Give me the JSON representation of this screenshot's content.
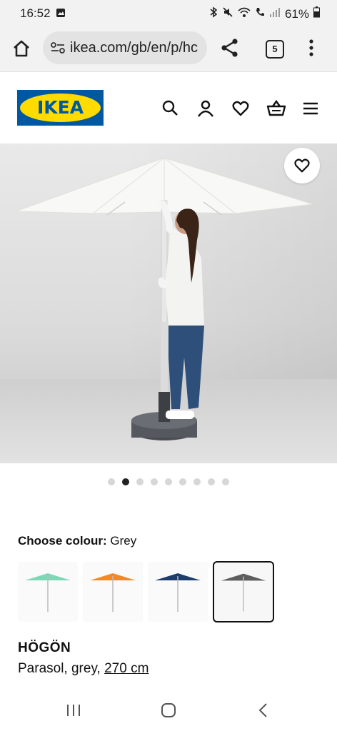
{
  "status": {
    "time": "16:52",
    "battery": "61%"
  },
  "browser": {
    "url": "ikea.com/gb/en/p/hc",
    "tab_count": "5"
  },
  "header": {
    "logo_text": "IKEA"
  },
  "gallery": {
    "image_count": 9,
    "active_index": 1
  },
  "colour": {
    "label": "Choose colour:",
    "selected": "Grey",
    "swatches": [
      {
        "name": "green",
        "color": "#7ed8b6"
      },
      {
        "name": "orange",
        "color": "#f08a24"
      },
      {
        "name": "blue",
        "color": "#1d3d6e"
      },
      {
        "name": "grey",
        "color": "#5d5d5d"
      }
    ]
  },
  "product": {
    "name": "HÖGÖN",
    "description_prefix": "Parasol, grey, ",
    "size_link": "270 cm"
  },
  "colors": {
    "ikea_blue": "#0058a3",
    "ikea_yellow": "#ffdb00"
  }
}
